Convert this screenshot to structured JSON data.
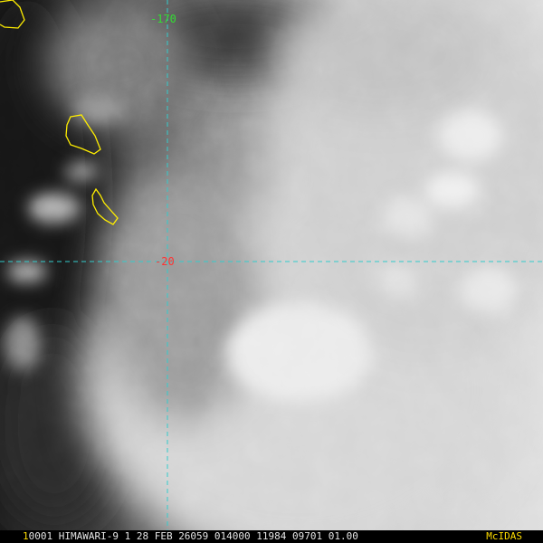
{
  "overlay": {
    "longitude_label": "-170",
    "latitude_label": "-20",
    "gridline_color": "#33cccc",
    "coastline_color": "#ffee00",
    "longitude_label_color": "#33dd33",
    "latitude_label_color": "#ff3333"
  },
  "status_bar": {
    "frame_number": "1",
    "info_text": "0001 HIMAWARI-9  1 28 FEB 26059 014000 11984 09701 01.00",
    "logo_text": "McIDAS"
  }
}
